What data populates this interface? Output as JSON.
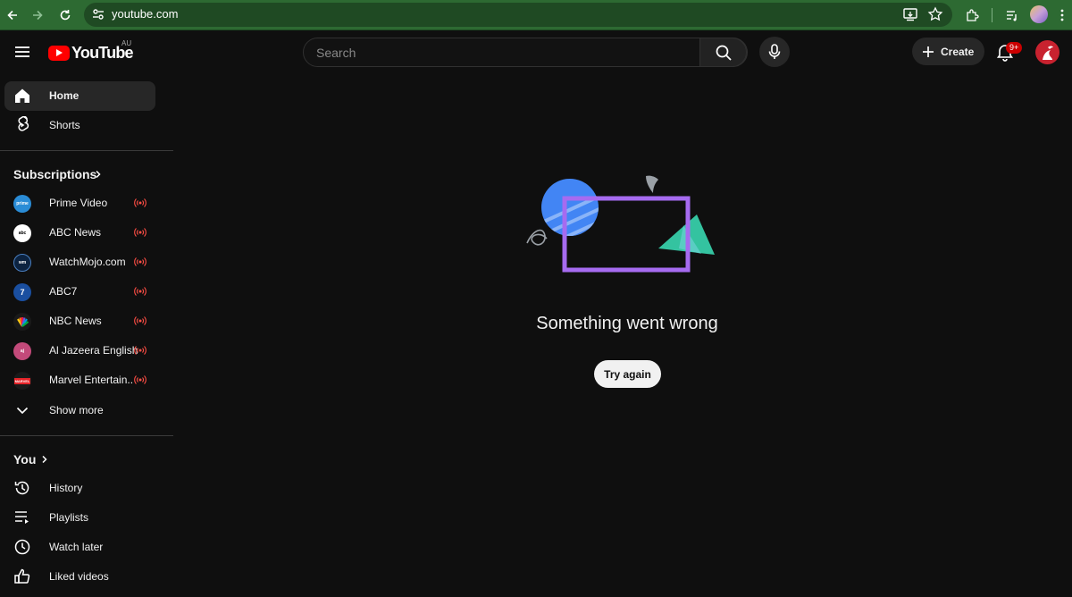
{
  "browser": {
    "url": "youtube.com"
  },
  "masthead": {
    "logo_text": "YouTube",
    "country_code": "AU",
    "search_placeholder": "Search",
    "create_label": "Create",
    "notification_count": "9+"
  },
  "sidebar": {
    "primary": [
      {
        "label": "Home",
        "icon": "home-icon",
        "active": true
      },
      {
        "label": "Shorts",
        "icon": "shorts-icon",
        "active": false
      }
    ],
    "subscriptions_heading": "Subscriptions",
    "subscriptions": [
      {
        "label": "Prime Video",
        "live": true,
        "avatar_color": "#2a8cd6",
        "avatar_text": "prime"
      },
      {
        "label": "ABC News",
        "live": true,
        "avatar_color": "#ffffff",
        "avatar_text": "abc"
      },
      {
        "label": "WatchMojo.com",
        "live": true,
        "avatar_color": "#0c2340",
        "avatar_text": "wm"
      },
      {
        "label": "ABC7",
        "live": true,
        "avatar_color": "#1a4fa0",
        "avatar_text": "7"
      },
      {
        "label": "NBC News",
        "live": true,
        "avatar_color": "#1a1a1a",
        "avatar_text": "nbc"
      },
      {
        "label": "Al Jazeera English",
        "live": true,
        "avatar_color": "#c34a7a",
        "avatar_text": "aj"
      },
      {
        "label": "Marvel Entertain...",
        "live": true,
        "avatar_color": "#1a1a1a",
        "avatar_text": "MARVEL"
      }
    ],
    "show_more_label": "Show more",
    "you_heading": "You",
    "you_items": [
      {
        "label": "History",
        "icon": "history-icon"
      },
      {
        "label": "Playlists",
        "icon": "playlists-icon"
      },
      {
        "label": "Watch later",
        "icon": "watch-later-icon"
      },
      {
        "label": "Liked videos",
        "icon": "liked-videos-icon"
      }
    ]
  },
  "main": {
    "error_message": "Something went wrong",
    "retry_label": "Try again"
  },
  "colors": {
    "accent_red": "#ff0000",
    "browser_green": "#2d6a32",
    "background": "#0f0f0f",
    "illustration_purple": "#a66bf0",
    "illustration_blue": "#4285f4",
    "illustration_teal": "#34c3a0"
  }
}
